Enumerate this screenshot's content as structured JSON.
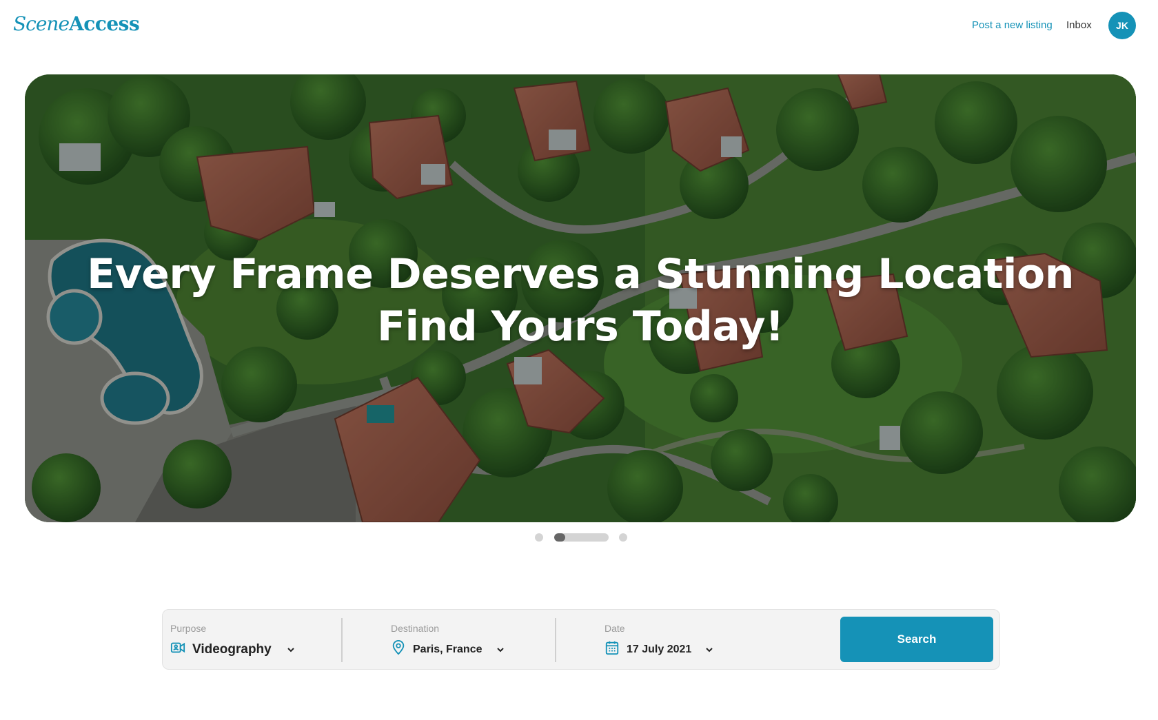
{
  "header": {
    "logo_part1": "Scene",
    "logo_part2": "Access",
    "post_listing_label": "Post a new listing",
    "inbox_label": "Inbox",
    "avatar_initials": "JK"
  },
  "hero": {
    "title_line1": "Every Frame Deserves a Stunning Location",
    "title_line2": "Find Yours Today!"
  },
  "carousel": {
    "slide_count": 3,
    "active_slide": 2,
    "active_progress": 0.2
  },
  "search": {
    "purpose": {
      "label": "Purpose",
      "value": "Videography",
      "icon": "video-camera-icon"
    },
    "destination": {
      "label": "Destination",
      "value": "Paris, France",
      "icon": "map-pin-icon"
    },
    "date": {
      "label": "Date",
      "value": "17 July 2021",
      "icon": "calendar-icon"
    },
    "button_label": "Search"
  },
  "colors": {
    "brand": "#1592b7",
    "search_bg": "#f3f3f3",
    "dot_inactive": "#d4d4d4",
    "dot_active": "#666666"
  }
}
